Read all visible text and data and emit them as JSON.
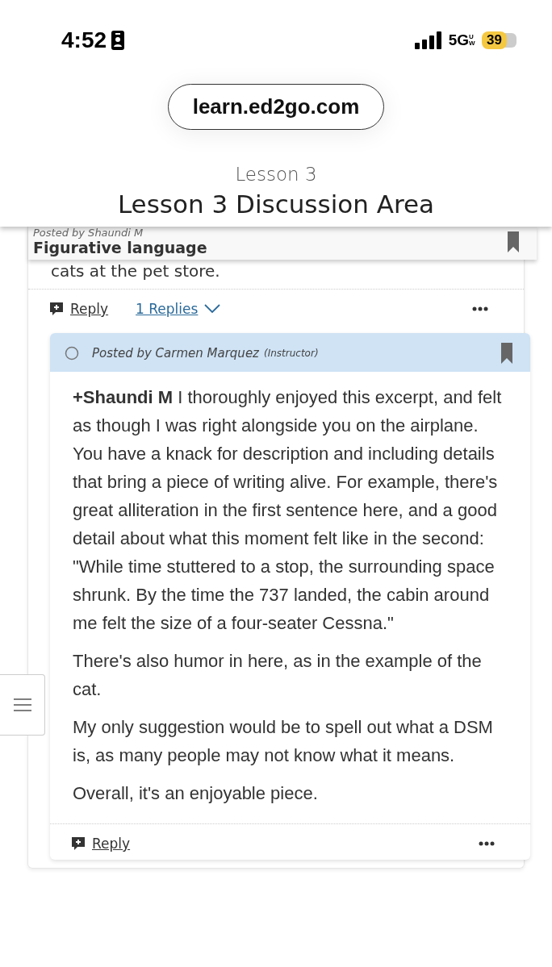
{
  "status_bar": {
    "time": "4:52",
    "network": "5G",
    "network_sub": "UW",
    "battery": "39"
  },
  "browser": {
    "url": "learn.ed2go.com"
  },
  "page": {
    "subtitle": "Lesson 3",
    "title": "Lesson 3 Discussion Area"
  },
  "post": {
    "author": "Posted by Shaundi M",
    "title": "Figurative language",
    "body_tail": "cats at the pet store.",
    "reply_label": "Reply",
    "replies_label": "1 Replies",
    "replies_expanded": true
  },
  "reply": {
    "author": "Posted by Carmen Marquez",
    "role": "(Instructor)",
    "paragraphs": [
      "**+Shaundi M** I thoroughly enjoyed this excerpt, and felt as though I was right alongside you on the airplane. You have a knack for description and including details that bring a piece of writing alive. For example, there's great alliteration in the first sentence here, and a good detail about what this moment felt like in the second: \"While time stuttered to a stop, the surrounding space shrunk. By the time the 737 landed, the cabin around me felt the size of a four-seater Cessna.\"",
      "There's also humor in here, as in the example of the cat.",
      "My only suggestion would be to spell out what a DSM is, as many people may not know what it means.",
      "Overall, it's an enjoyable piece."
    ],
    "reply_label": "Reply"
  }
}
